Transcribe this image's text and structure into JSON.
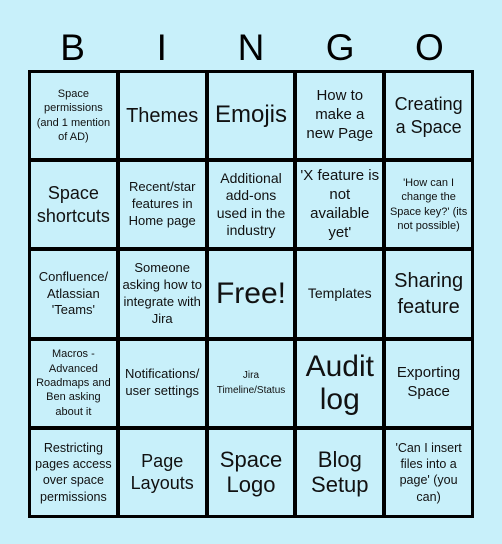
{
  "title_letters": [
    "B",
    "I",
    "N",
    "G",
    "O"
  ],
  "colors": {
    "background": "#c8f0fa",
    "cell": "#c8f0fa",
    "grid": "#000000"
  },
  "cells": [
    [
      "Space permissions (and 1 mention of AD)",
      "Themes",
      "Emojis",
      "How to make a new Page",
      "Creating a Space"
    ],
    [
      "Space shortcuts",
      "Recent/star features in Home page",
      "Additional add-ons used in the industry",
      "'X feature is not available yet'",
      "'How can I change the Space key?' (its not possible)"
    ],
    [
      "Confluence/ Atlassian 'Teams'",
      "Someone asking how to integrate with Jira",
      "Free!",
      "Templates",
      "Sharing feature"
    ],
    [
      "Macros - Advanced Roadmaps and Ben asking about it",
      "Notifications/ user settings",
      "Jira Timeline/Status",
      "Audit log",
      "Exporting Space"
    ],
    [
      "Restricting pages access over space permissions",
      "Page Layouts",
      "Space Logo",
      "Blog Setup",
      "'Can I insert files into a page' (you can)"
    ]
  ]
}
